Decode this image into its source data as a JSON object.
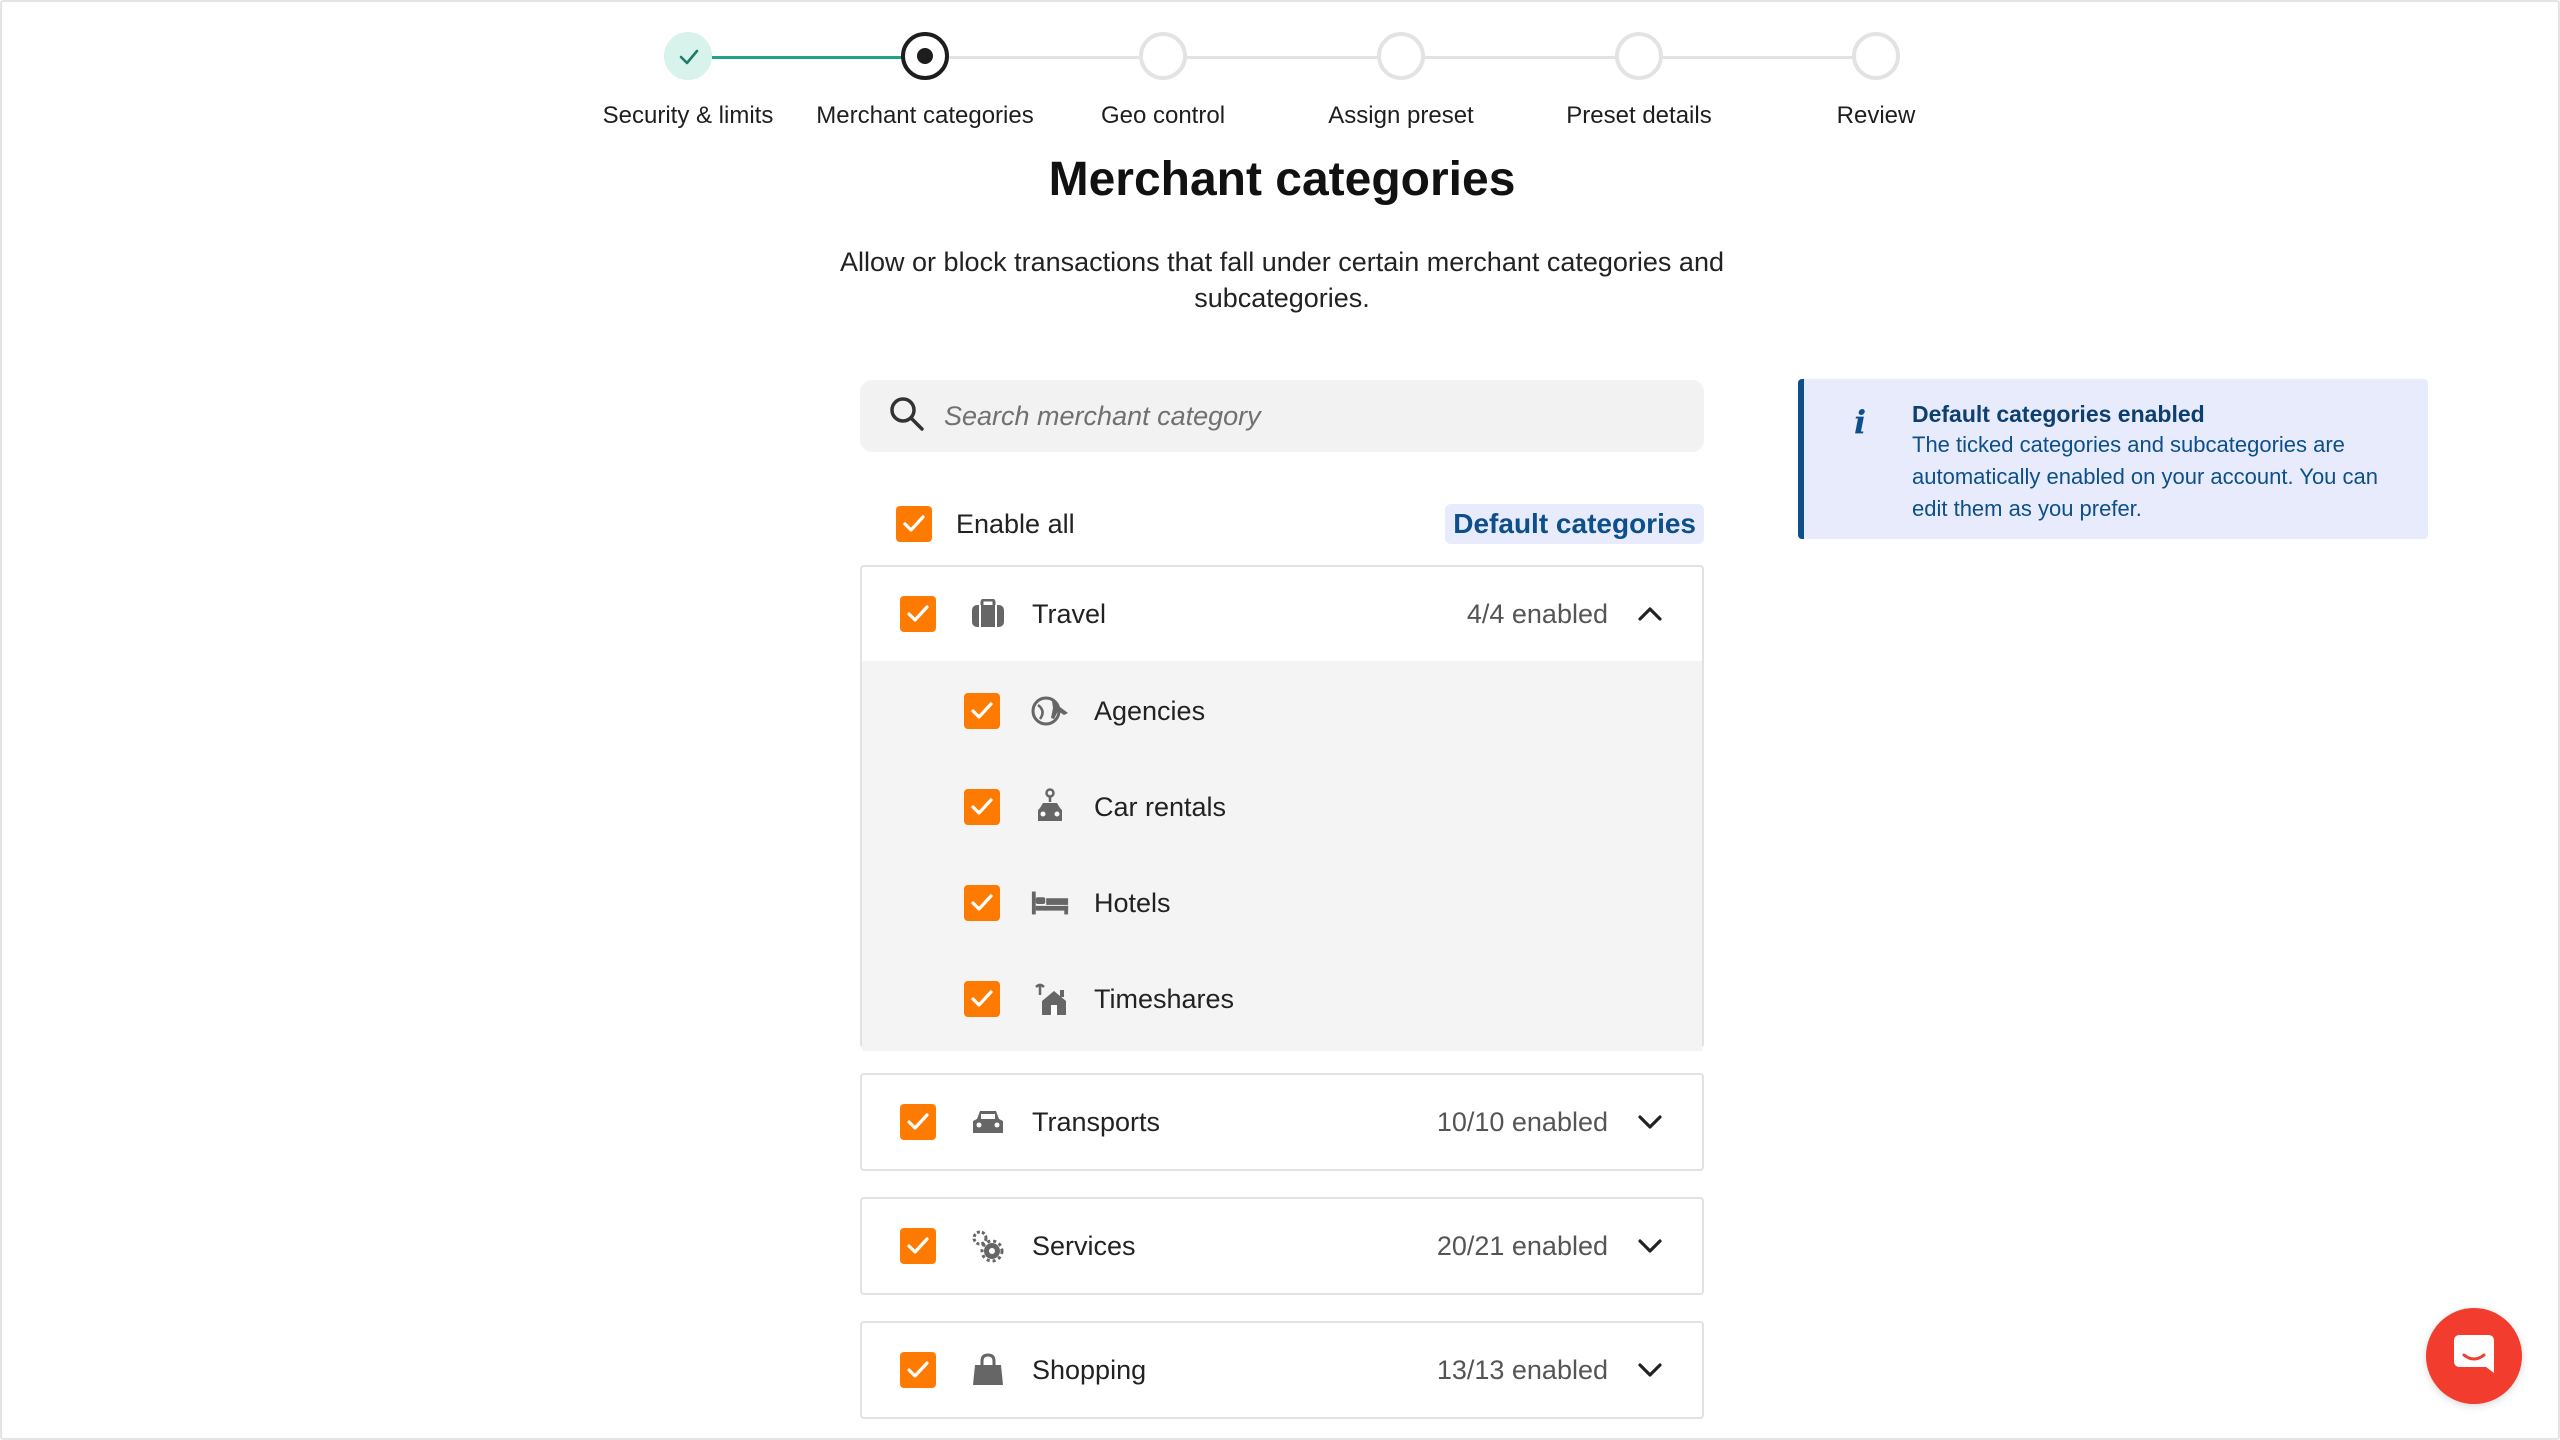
{
  "stepper": {
    "steps": [
      {
        "label": "Security & limits",
        "state": "done"
      },
      {
        "label": "Merchant categories",
        "state": "active"
      },
      {
        "label": "Geo control",
        "state": "pending"
      },
      {
        "label": "Assign preset",
        "state": "pending"
      },
      {
        "label": "Preset details",
        "state": "pending"
      },
      {
        "label": "Review",
        "state": "pending"
      }
    ]
  },
  "page": {
    "title": "Merchant categories",
    "subtitle": "Allow or block transactions that fall under certain merchant categories and subcategories."
  },
  "search": {
    "placeholder": "Search merchant category",
    "value": ""
  },
  "enable_all": {
    "label": "Enable all",
    "checked": true
  },
  "default_categories_label": "Default categories",
  "categories": [
    {
      "name": "Travel",
      "count": "4/4 enabled",
      "expanded": true,
      "icon": "suitcase-icon",
      "checked": true,
      "subcategories": [
        {
          "name": "Agencies",
          "icon": "globe-plane-icon",
          "checked": true
        },
        {
          "name": "Car rentals",
          "icon": "car-key-icon",
          "checked": true
        },
        {
          "name": "Hotels",
          "icon": "bed-icon",
          "checked": true
        },
        {
          "name": "Timeshares",
          "icon": "house-icon",
          "checked": true
        }
      ]
    },
    {
      "name": "Transports",
      "count": "10/10 enabled",
      "expanded": false,
      "icon": "car-icon",
      "checked": true
    },
    {
      "name": "Services",
      "count": "20/21 enabled",
      "expanded": false,
      "icon": "gears-icon",
      "checked": true
    },
    {
      "name": "Shopping",
      "count": "13/13 enabled",
      "expanded": false,
      "icon": "shopping-bag-icon",
      "checked": true
    }
  ],
  "info": {
    "title": "Default categories enabled",
    "body": "The ticked categories and subcategories are automatically enabled on your account. You can edit them as you prefer."
  },
  "colors": {
    "accent_orange": "#ff7a00",
    "success_green": "#1ea387",
    "info_blue": "#0d4f8b",
    "info_bg": "#e7ebfb",
    "chat_red": "#f23c2d"
  }
}
